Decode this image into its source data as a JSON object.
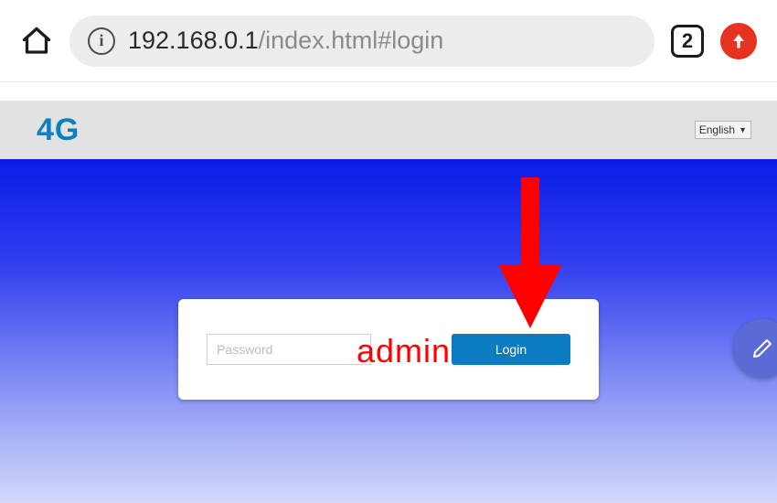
{
  "chrome": {
    "url_host": "192.168.0.1",
    "url_path": "/index.html#login",
    "tab_count": "2"
  },
  "header": {
    "logo": "4G",
    "language": "English"
  },
  "login": {
    "password_placeholder": "Password",
    "password_value": "",
    "login_button": "Login"
  },
  "annotation": {
    "text": "admin"
  },
  "colors": {
    "accent_red": "#e53320",
    "brand_teal": "#0b7fbf",
    "login_btn": "#0a7cbf",
    "annotation_red": "#ff0000"
  }
}
